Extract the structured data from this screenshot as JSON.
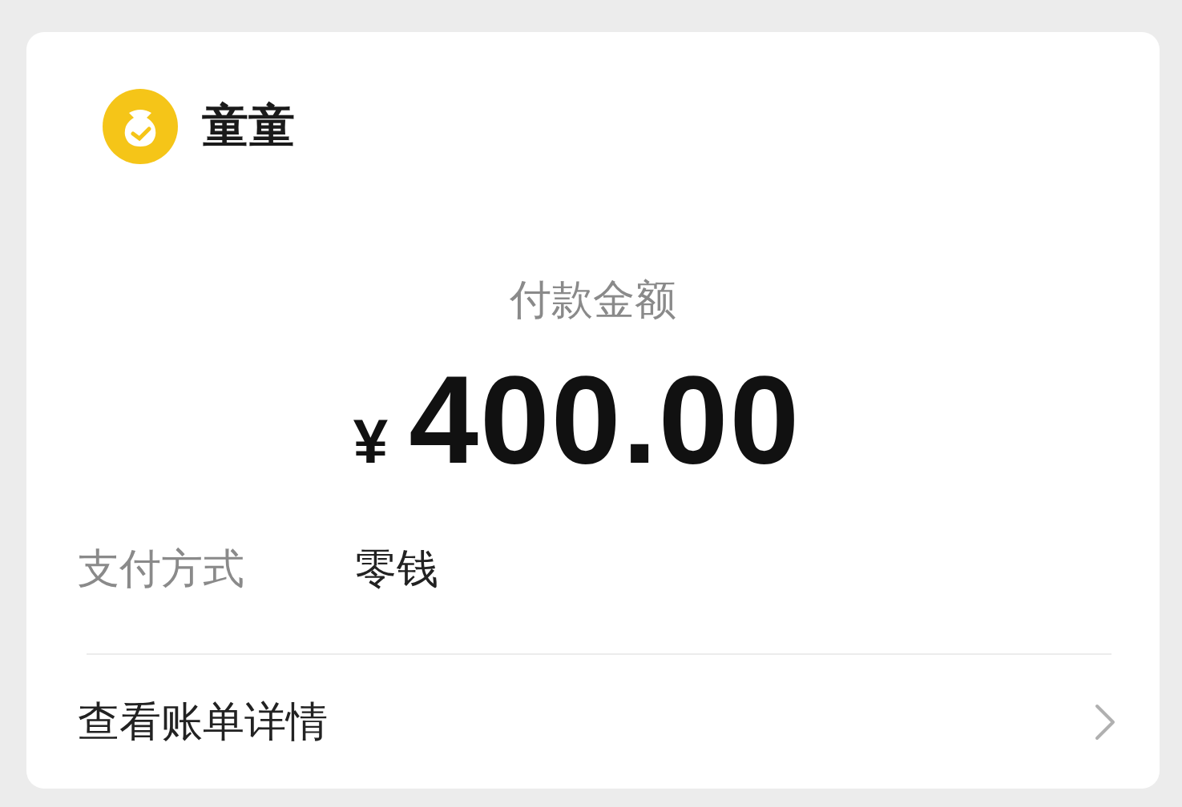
{
  "payee": {
    "name": "童童"
  },
  "amount_label": "付款金额",
  "currency": "¥",
  "amount": "400.00",
  "payment_method": {
    "label": "支付方式",
    "value": "零钱"
  },
  "bill_link": {
    "label": "查看账单详情"
  }
}
